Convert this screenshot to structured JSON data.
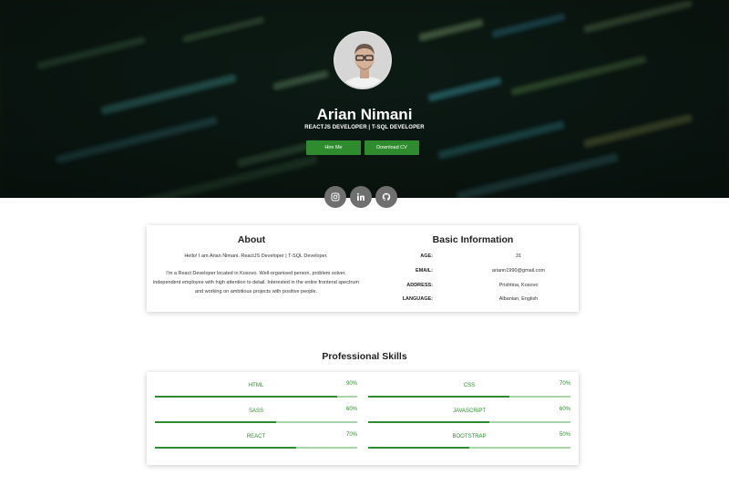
{
  "profile": {
    "name": "Arian Nimani",
    "roles": "REACTJS DEVELOPER | T-SQL DEVELOPER",
    "hire_label": "Hire Me",
    "download_label": "Download CV"
  },
  "social": [
    {
      "icon": "instagram-icon"
    },
    {
      "icon": "linkedin-icon"
    },
    {
      "icon": "github-icon"
    }
  ],
  "about": {
    "title": "About",
    "intro": "Hello! I am Arian Nimani. ReactJS Developer | T-SQL Developer.",
    "text": "I'm a React Developer located in Kosovo. Well-organised person, problem solver, independent employee with high attention to detail. Interested in the entire frontend spectrum and working on ambitious projects with positive people."
  },
  "info": {
    "title": "Basic Information",
    "rows": [
      {
        "label": "AGE:",
        "value": "31"
      },
      {
        "label": "EMAIL:",
        "value": "ariann1990@gmail.com"
      },
      {
        "label": "ADDRESS:",
        "value": "Prishtina, Kosovo"
      },
      {
        "label": "LANGUAGE:",
        "value": "Albanian, English"
      }
    ]
  },
  "skills": {
    "title": "Professional Skills",
    "items": [
      {
        "name": "HTML",
        "pct_label": "90%",
        "level": 0.9
      },
      {
        "name": "CSS",
        "pct_label": "70%",
        "level": 0.7
      },
      {
        "name": "SASS",
        "pct_label": "60%",
        "level": 0.6
      },
      {
        "name": "JAVASCRIPT",
        "pct_label": "60%",
        "level": 0.6
      },
      {
        "name": "REACT",
        "pct_label": "70%",
        "level": 0.7
      },
      {
        "name": "BOOTSTRAP",
        "pct_label": "50%",
        "level": 0.5
      }
    ]
  },
  "colors": {
    "accent": "#2e8b2e",
    "accent_light": "#a9d4a9",
    "social_bg": "#6f6f6f"
  }
}
